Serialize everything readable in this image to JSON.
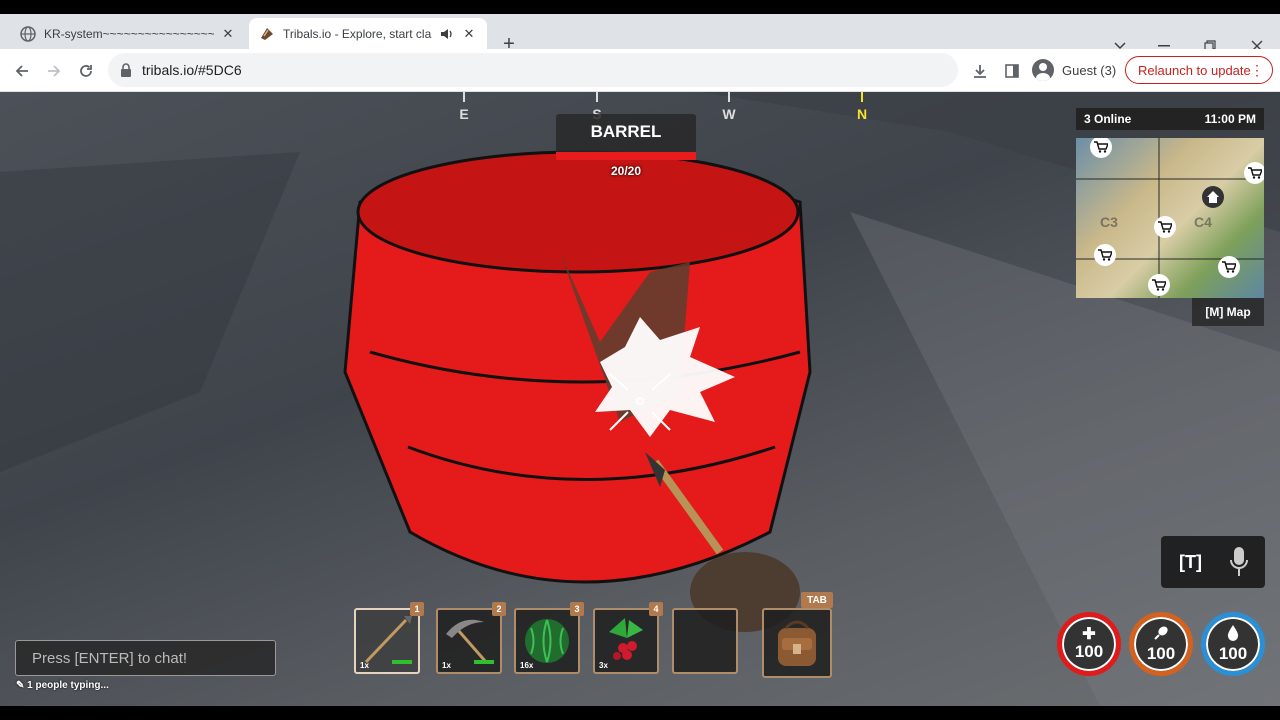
{
  "browser": {
    "tabs": [
      {
        "title": "KR-system~~~~~~~~~~~~~~~~",
        "active": false
      },
      {
        "title": "Tribals.io - Explore, start cla",
        "active": true
      }
    ],
    "url": "tribals.io/#5DC6",
    "profile_label": "Guest (3)",
    "relaunch_label": "Relaunch to update"
  },
  "game": {
    "compass": [
      "E",
      "S",
      "W",
      "N"
    ],
    "target": {
      "name": "BARREL",
      "hp_text": "20/20",
      "hp_fraction": 1.0
    },
    "minimap": {
      "online": "3 Online",
      "time": "11:00 PM",
      "grid_labels": [
        "C3",
        "C4"
      ],
      "map_button": "[M] Map"
    },
    "voice_key": "[T]",
    "hotbar": [
      {
        "num": "1",
        "qty": "1x",
        "item": "spear-icon",
        "durability": 0.9,
        "selected": true
      },
      {
        "num": "2",
        "qty": "1x",
        "item": "pickaxe-icon",
        "durability": 0.9,
        "selected": false
      },
      {
        "num": "3",
        "qty": "16x",
        "item": "watermelon-icon",
        "durability": null,
        "selected": false
      },
      {
        "num": "4",
        "qty": "3x",
        "item": "berries-icon",
        "durability": null,
        "selected": false
      },
      {
        "num": "",
        "qty": "",
        "item": "",
        "durability": null,
        "selected": false
      }
    ],
    "bag_key": "TAB",
    "chat_placeholder": "Press [ENTER] to chat!",
    "typing_status": "1 people typing...",
    "stats": [
      {
        "name": "health",
        "value": "100",
        "color": "#e11b1b"
      },
      {
        "name": "food",
        "value": "100",
        "color": "#d4621e"
      },
      {
        "name": "water",
        "value": "100",
        "color": "#2b8fd6"
      }
    ]
  }
}
